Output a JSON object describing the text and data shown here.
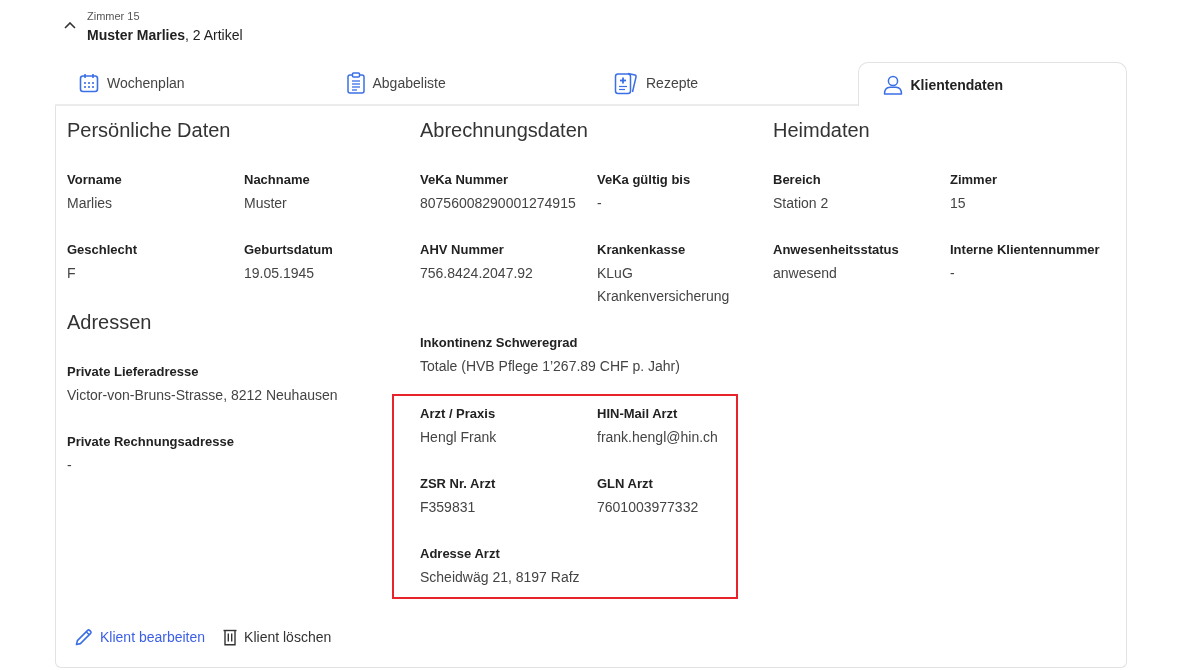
{
  "header": {
    "expanded": true,
    "room": "Zimmer 15",
    "title": "**Muster Marlies**, 2 Artikel"
  },
  "tabs": [
    {
      "label": "Wochenplan",
      "selected": false
    },
    {
      "label": "Abgabeliste",
      "selected": false
    },
    {
      "label": "Rezepte",
      "selected": false
    },
    {
      "label": "Klientendaten",
      "selected": true
    }
  ],
  "columns": [
    {
      "sections": [
        {
          "kind": "plain",
          "title": "Persönliche Daten",
          "rows": [
            [
              {
                "label": "Vorname",
                "value": "Marlies"
              },
              {
                "label": "Nachname",
                "value": "Muster"
              }
            ],
            [
              {
                "label": "Geschlecht",
                "value": "F"
              },
              {
                "label": "Geburtsdatum",
                "value": "19.05.1945"
              }
            ]
          ]
        },
        {
          "kind": "plain",
          "title": "Adressen",
          "rows": [
            [
              {
                "label": "Private Lieferadresse",
                "value": "Victor-von-Bruns-Strasse, 8212 Neuhausen"
              }
            ],
            [
              {
                "label": "Private Rechnungsadresse",
                "value": "-"
              }
            ]
          ]
        }
      ]
    },
    {
      "sections": [
        {
          "kind": "plain",
          "title": "Abrechnungsdaten",
          "rows": [
            [
              {
                "label": "VeKa Nummer",
                "value": "80756008290001274915"
              },
              {
                "label": "VeKa gültig bis",
                "value": "-"
              }
            ],
            [
              {
                "label": "AHV Nummer",
                "value": "756.8424.2047.92"
              },
              {
                "label": "Krankenkasse",
                "value": "KLuG Krankenversicherung"
              }
            ],
            [
              {
                "label": "Inkontinenz Schweregrad",
                "value": "Totale (HVB Pflege 1’267.89 CHF p. Jahr)"
              }
            ]
          ]
        },
        {
          "kind": "framed",
          "rows": [
            [
              {
                "label": "Arzt / Praxis",
                "value": "Hengl Frank"
              },
              {
                "label": "HIN-Mail Arzt",
                "value": "frank.hengl@hin.ch"
              }
            ],
            [
              {
                "label": "ZSR Nr. Arzt",
                "value": "F359831"
              },
              {
                "label": "GLN Arzt",
                "value": "7601003977332"
              }
            ],
            [
              {
                "label": "Adresse Arzt",
                "value": "Scheidwäg 21, 8197 Rafz"
              }
            ]
          ]
        }
      ]
    },
    {
      "sections": [
        {
          "kind": "plain",
          "title": "Heimdaten",
          "rows": [
            [
              {
                "label": "Bereich",
                "value": "Station 2"
              },
              {
                "label": "Zimmer",
                "value": "15"
              }
            ],
            [
              {
                "label": "Anwesenheitsstatus",
                "value": "anwesend"
              },
              {
                "label": "Interne Klientennummer",
                "value": "-"
              }
            ]
          ]
        }
      ]
    }
  ],
  "actions": [
    {
      "kind": "edit",
      "label": "Klient bearbeiten"
    },
    {
      "kind": "delete",
      "label": "Klient löschen"
    }
  ]
}
